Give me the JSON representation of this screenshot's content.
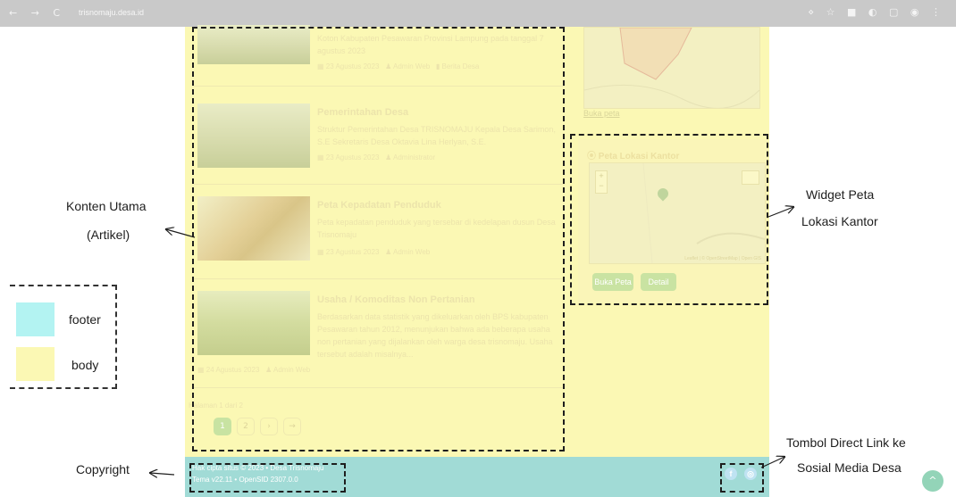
{
  "browser": {
    "nav_icons": "← → C",
    "url": "trisnomaju.desa.id",
    "right_icons": "⋄ ☆ ■ ◐ ▢ ◉ ⋮"
  },
  "articles": [
    {
      "title": "",
      "excerpt": "Koton Kabupaten Pesawaran Provinsi Lampung pada tanggal 7 agustus 2023",
      "date": "23 Agustus 2023",
      "author": "Admin Web",
      "category": "Berita Desa"
    },
    {
      "title": "Pemerintahan Desa",
      "excerpt": "Struktur Pemerintahan Desa TRISNOMAJU Kepala Desa Sarimon, S.E Sekretaris Desa Oktavia Lina Herlyan, S.E.",
      "date": "23 Agustus 2023",
      "author": "Administrator",
      "category": ""
    },
    {
      "title": "Peta Kepadatan Penduduk",
      "excerpt": "Peta kepadatan penduduk yang tersebar di kedelapan dusun Desa Trisnomaju",
      "date": "23 Agustus 2023",
      "author": "Admin Web",
      "category": ""
    },
    {
      "title": "Usaha / Komoditas Non Pertanian",
      "excerpt": "Berdasarkan data statistik yang dikeluarkan oleh BPS kabupaten Pesawaran tahun 2012, menunjukan bahwa ada beberapa usaha non pertanian yang dijalankan oleh warga desa trisnomaju. Usaha tersebut adalah misalnya...",
      "date": "24 Agustus 2023",
      "author": "Admin Web",
      "category": ""
    }
  ],
  "pagination": {
    "label": "Halaman 1 dari 2",
    "pages": [
      "1",
      "2",
      "›",
      "→"
    ]
  },
  "sidebar": {
    "map_link": "Buka peta",
    "widget_title": "Peta Lokasi Kantor",
    "map_zoom_in": "+",
    "map_zoom_out": "−",
    "map_attribution": "Leaflet | © OpenStreetMap | Open GIS",
    "btn_open_map": "Buka Peta",
    "btn_detail": "Detail"
  },
  "footer": {
    "copyright_line1": "Hak cipta situs © 2023 • Desa Trisnomaju",
    "copyright_line2": "Tema v22.11 • OpenSID 2307.0.0",
    "social": [
      "f",
      "◎"
    ]
  },
  "annotations": {
    "konten_utama_1": "Konten Utama",
    "konten_utama_2": "(Artikel)",
    "widget_1": "Widget Peta",
    "widget_2": "Lokasi Kantor",
    "copyright": "Copyright",
    "tombol_1": "Tombol Direct Link ke",
    "tombol_2": "Sosial Media Desa"
  },
  "legend": {
    "footer_label": "footer",
    "body_label": "body",
    "footer_color": "#b3f3f2",
    "body_color": "#fbf8b4"
  },
  "back_to_top": "^"
}
